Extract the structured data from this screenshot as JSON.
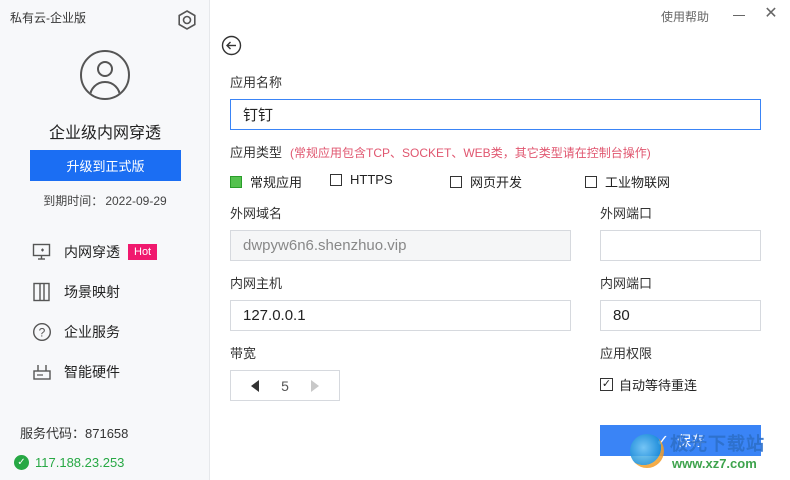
{
  "sidebar": {
    "app_title": "私有云-企业版",
    "product_name": "企业级内网穿透",
    "upgrade_label": "升级到正式版",
    "expire_label": "到期时间：",
    "expire_value": "2022-09-29",
    "nav": [
      {
        "label": "内网穿透",
        "icon": "monitor-icon",
        "badge": "Hot"
      },
      {
        "label": "场景映射",
        "icon": "layout-icon"
      },
      {
        "label": "企业服务",
        "icon": "question-icon"
      },
      {
        "label": "智能硬件",
        "icon": "router-icon"
      }
    ],
    "service_code_label": "服务代码：",
    "service_code": "871658",
    "ip": "117.188.23.253"
  },
  "topbar": {
    "help": "使用帮助"
  },
  "form": {
    "app_name_label": "应用名称",
    "app_name_value": "钉钉",
    "app_type_label": "应用类型",
    "app_type_note": "(常规应用包含TCP、SOCKET、WEB类，其它类型请在控制台操作)",
    "app_types": [
      {
        "label": "常规应用",
        "selected": true
      },
      {
        "label": "HTTPS",
        "selected": false
      },
      {
        "label": "网页开发",
        "selected": false
      },
      {
        "label": "工业物联网",
        "selected": false
      }
    ],
    "external_domain_label": "外网域名",
    "external_domain_value": "dwpyw6n6.shenzhuo.vip",
    "external_port_label": "外网端口",
    "external_port_value": "",
    "internal_host_label": "内网主机",
    "internal_host_value": "127.0.0.1",
    "internal_port_label": "内网端口",
    "internal_port_value": "80",
    "bandwidth_label": "带宽",
    "bandwidth_value": "5",
    "permission_label": "应用权限",
    "auto_reconnect_label": "自动等待重连",
    "auto_reconnect_checked": true,
    "save_label": "保存"
  },
  "watermark": {
    "line1": "极光下载站",
    "line2": "www.xz7.com"
  },
  "colors": {
    "primary": "#1b6ef3",
    "save": "#3a84f6",
    "hot": "#f0196e",
    "online": "#27a844",
    "note": "#e0566f"
  }
}
